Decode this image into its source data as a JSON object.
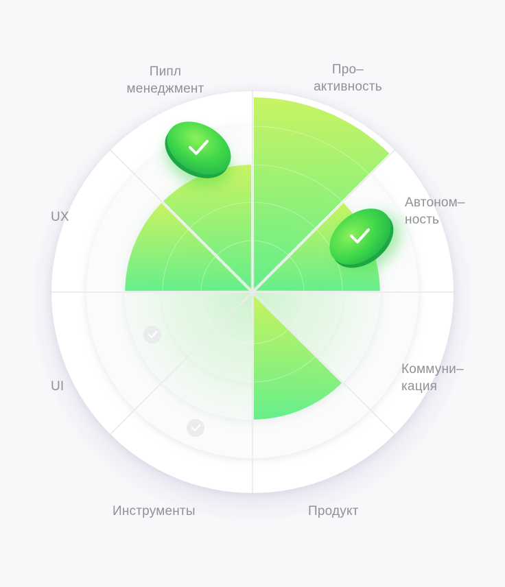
{
  "chart_data": {
    "type": "radar-sectors",
    "title": "",
    "levels": 4,
    "categories": [
      {
        "label": "Про–\nактивность",
        "value": 4,
        "marker": "none"
      },
      {
        "label": "Автоном–\nность",
        "value": 3,
        "marker": "check-badge-large"
      },
      {
        "label": "Коммуни–\nкация",
        "value": 0,
        "marker": "none"
      },
      {
        "label": "Продукт",
        "value": 3,
        "marker": "none"
      },
      {
        "label": "Инструменты",
        "value": 0,
        "marker": "check-badge-small"
      },
      {
        "label": "UI",
        "value": 0,
        "marker": "check-badge-small"
      },
      {
        "label": "UX",
        "value": 3,
        "marker": "none"
      },
      {
        "label": "Пипл\nменеджмент",
        "value": 3,
        "marker": "check-badge-large"
      }
    ]
  },
  "colors": {
    "background": "#f8f8fa",
    "ring_fill": "#ffffff",
    "center_glow": "#d9f5d9",
    "sector_top": "#c6f35a",
    "sector_bottom": "#5fee86",
    "badge_green": "#3dd64a",
    "label": "#8f9196",
    "divider": "#e7e7ea"
  },
  "icons": {
    "large_badge": "checkmark-icon",
    "small_badge": "checkmark-icon"
  }
}
